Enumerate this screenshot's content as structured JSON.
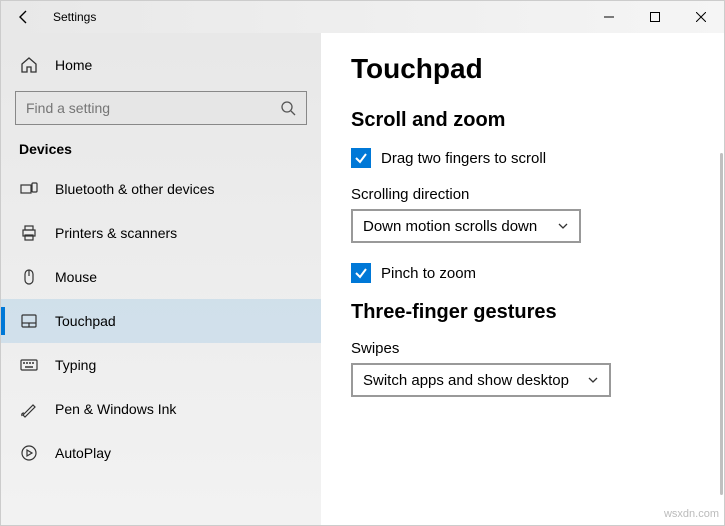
{
  "titlebar": {
    "title": "Settings"
  },
  "sidebar": {
    "home_label": "Home",
    "search_placeholder": "Find a setting",
    "category_label": "Devices",
    "items": [
      {
        "label": "Bluetooth & other devices"
      },
      {
        "label": "Printers & scanners"
      },
      {
        "label": "Mouse"
      },
      {
        "label": "Touchpad"
      },
      {
        "label": "Typing"
      },
      {
        "label": "Pen & Windows Ink"
      },
      {
        "label": "AutoPlay"
      }
    ]
  },
  "main": {
    "page_title": "Touchpad",
    "section1_title": "Scroll and zoom",
    "drag_two_fingers_label": "Drag two fingers to scroll",
    "scrolling_direction_label": "Scrolling direction",
    "scrolling_direction_value": "Down motion scrolls down",
    "pinch_to_zoom_label": "Pinch to zoom",
    "section2_title": "Three-finger gestures",
    "swipes_label": "Swipes",
    "swipes_value": "Switch apps and show desktop"
  },
  "watermark": "wsxdn.com"
}
